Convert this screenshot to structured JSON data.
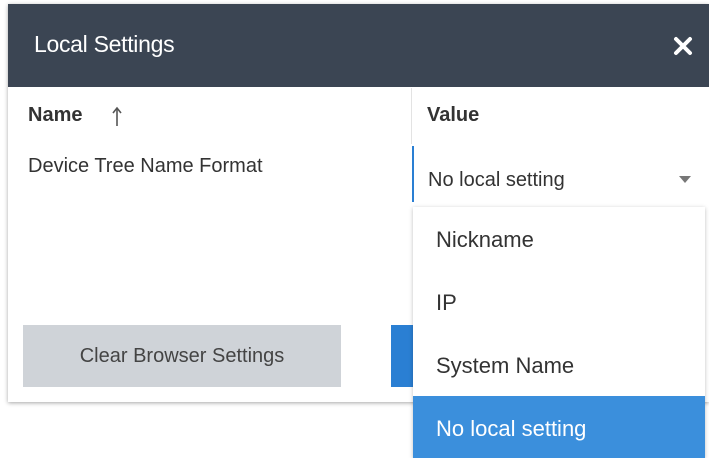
{
  "dialog": {
    "title": "Local Settings",
    "close_icon": "close-icon"
  },
  "table": {
    "columns": [
      {
        "label": "Name",
        "sort": "ascending"
      },
      {
        "label": "Value"
      }
    ],
    "rows": [
      {
        "name": "Device Tree Name Format",
        "value": "No local setting"
      }
    ]
  },
  "dropdown": {
    "options": [
      "Nickname",
      "IP",
      "System Name",
      "No local setting"
    ],
    "selected": "No local setting"
  },
  "footer": {
    "clear_label": "Clear Browser Settings"
  },
  "colors": {
    "header_bg": "#3b4553",
    "accent": "#2a7fd3",
    "selected_bg": "#3b8fdc",
    "button_bg": "#cfd3d8"
  }
}
